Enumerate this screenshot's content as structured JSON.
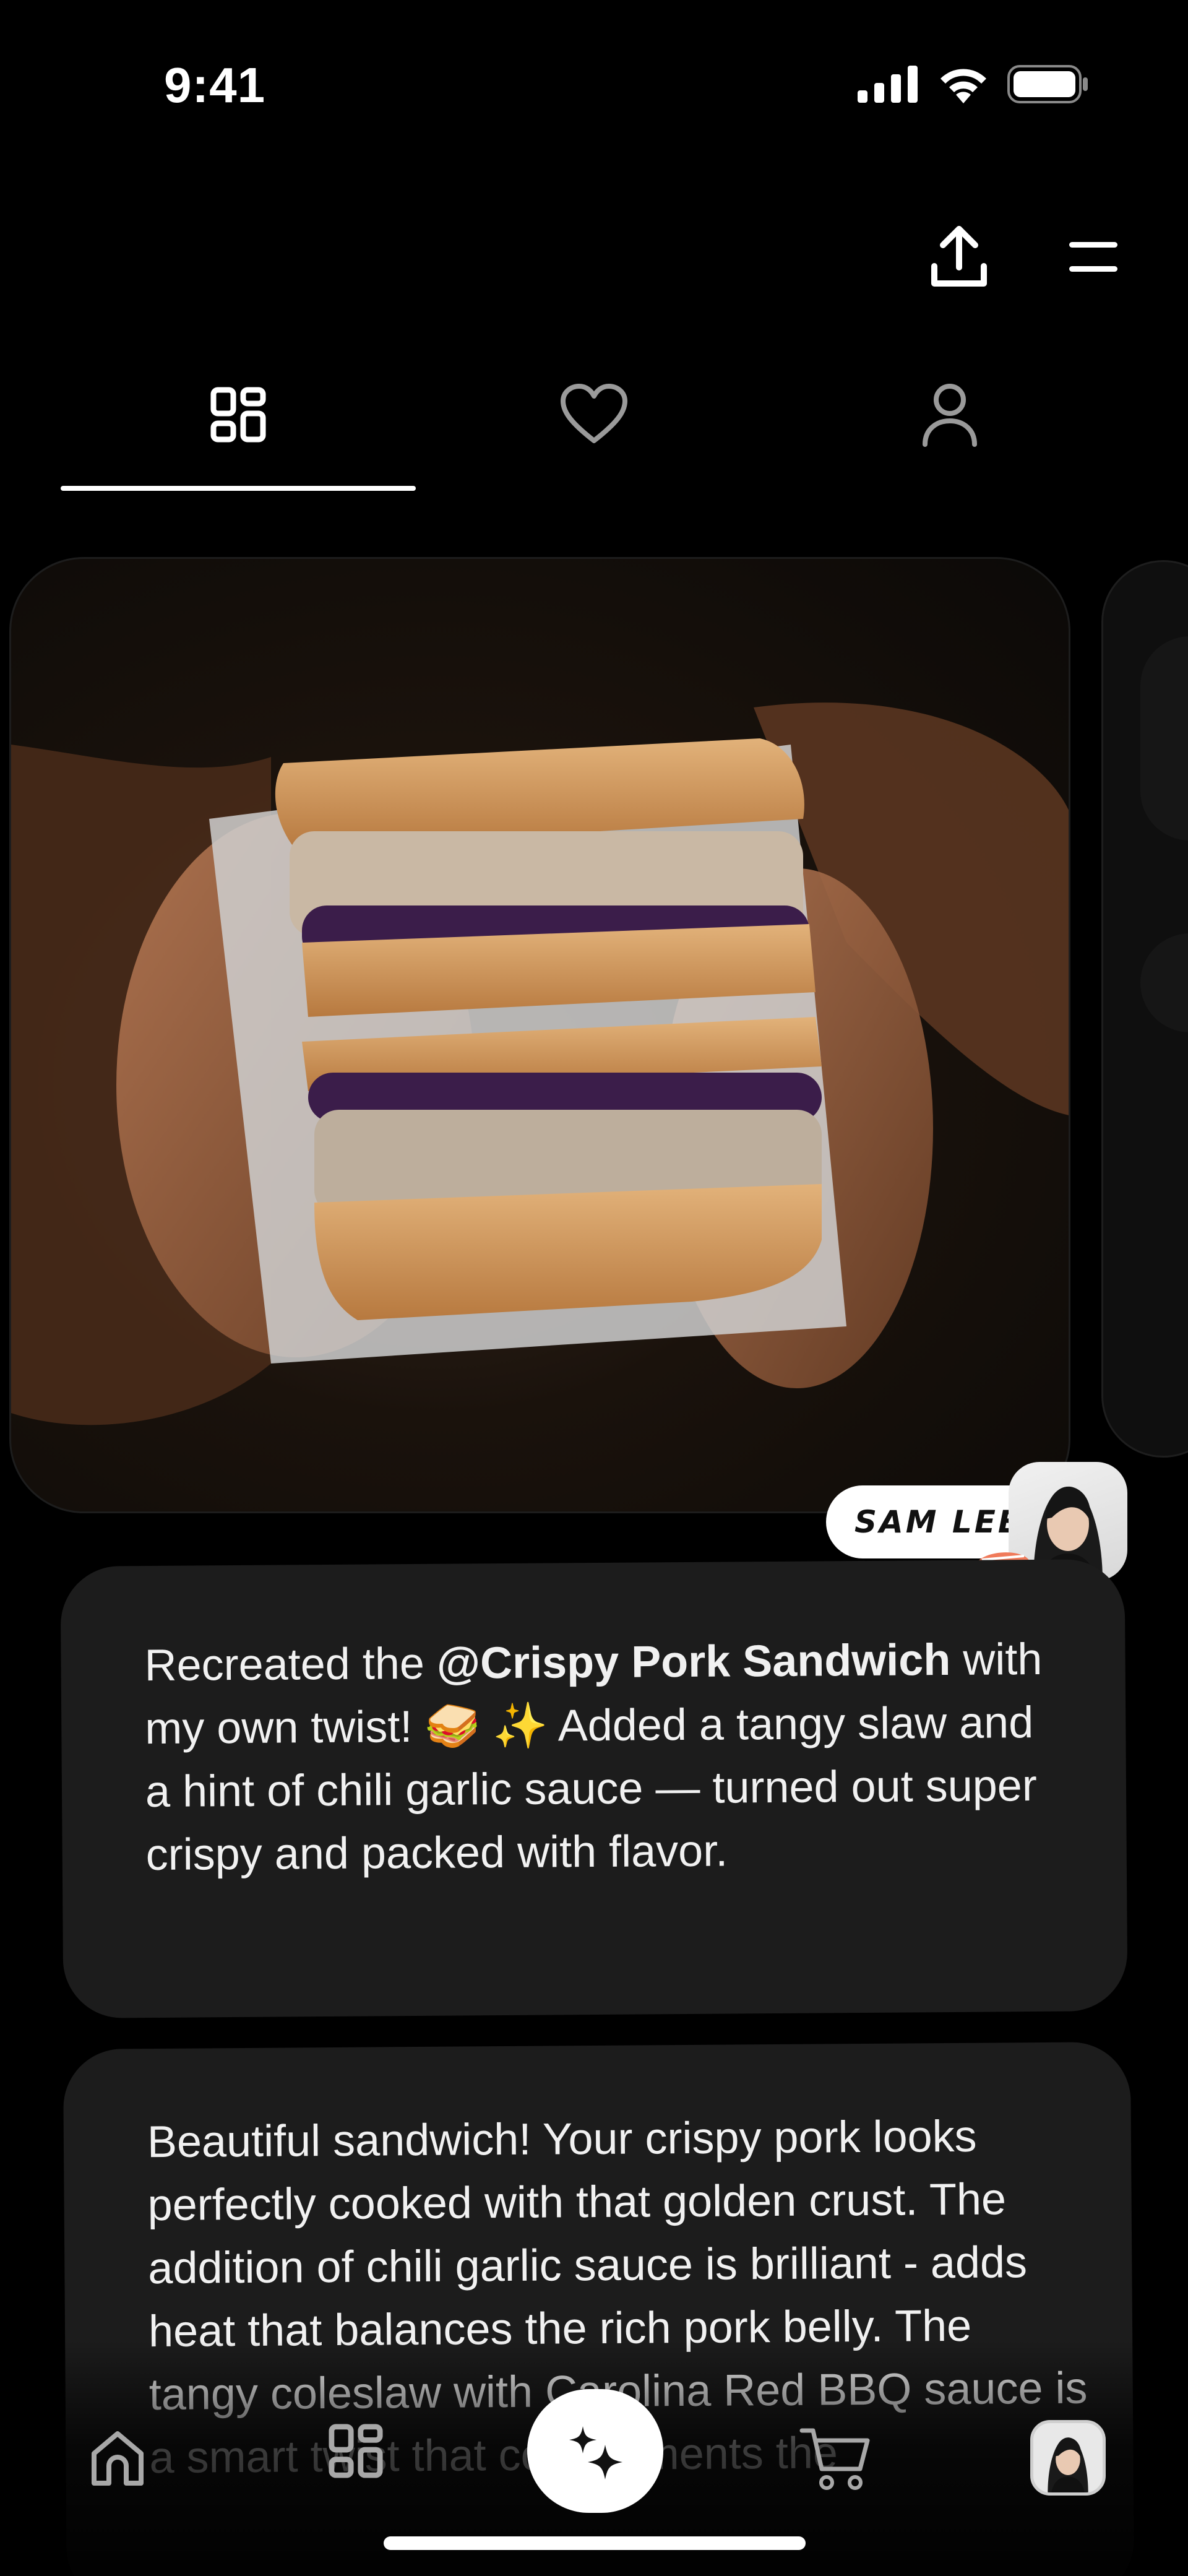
{
  "status_bar": {
    "time": "9:41",
    "icons": [
      "signal-icon",
      "wifi-icon",
      "battery-icon"
    ]
  },
  "header": {
    "actions": [
      "share-icon",
      "menu-icon"
    ]
  },
  "tabs": [
    {
      "icon": "grid-icon",
      "active": true
    },
    {
      "icon": "heart-icon",
      "active": false
    },
    {
      "icon": "profile-icon",
      "active": false
    }
  ],
  "post": {
    "author_name": "SAM LEE",
    "caption_prefix": "Recreated the ",
    "mention": "@Crispy Pork Sandwich",
    "caption_rest": " with my own twist! 🥪 ✨ Added a tangy slaw and a hint of chili garlic sauce — turned out super crispy and packed with flavor."
  },
  "reply": {
    "text": "Beautiful sandwich! Your crispy pork looks perfectly cooked with that golden crust. The addition of chili garlic sauce is brilliant - adds heat that balances the rich pork belly. The tangy coleslaw with Carolina Red BBQ sauce is a smart twist that complements the"
  },
  "bottom_nav": {
    "items": [
      "home-icon",
      "grid-icon",
      "sparkle-icon",
      "cart-icon",
      "avatar"
    ]
  },
  "colors": {
    "background": "#000000",
    "card": "#1c1c1c",
    "text": "#ffffff",
    "accent_white": "#ffffff"
  }
}
